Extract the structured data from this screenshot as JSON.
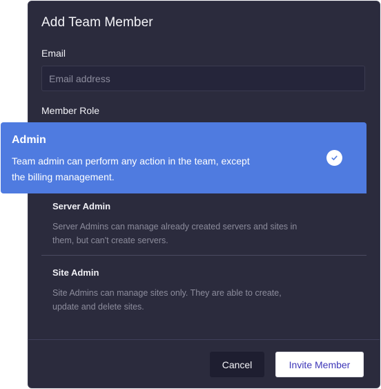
{
  "modal": {
    "title": "Add Team Member",
    "email": {
      "label": "Email",
      "placeholder": "Email address",
      "value": ""
    },
    "member_role": {
      "label": "Member Role",
      "selected": {
        "name": "Admin",
        "description": "Team admin can perform any action in the team, except the billing management."
      },
      "options": [
        {
          "name": "Server Admin",
          "description": "Server Admins can manage already created servers and sites in them, but can't create servers."
        },
        {
          "name": "Site Admin",
          "description": "Site Admins can manage sites only. They are able to create, update and delete sites."
        }
      ]
    },
    "buttons": {
      "cancel": "Cancel",
      "invite": "Invite Member"
    }
  },
  "icons": {
    "selected_check": "check-circle-icon"
  },
  "colors": {
    "modal_bg": "#2b2b3d",
    "selected_bg": "#4f7be0",
    "invite_text": "#3d36b8"
  }
}
